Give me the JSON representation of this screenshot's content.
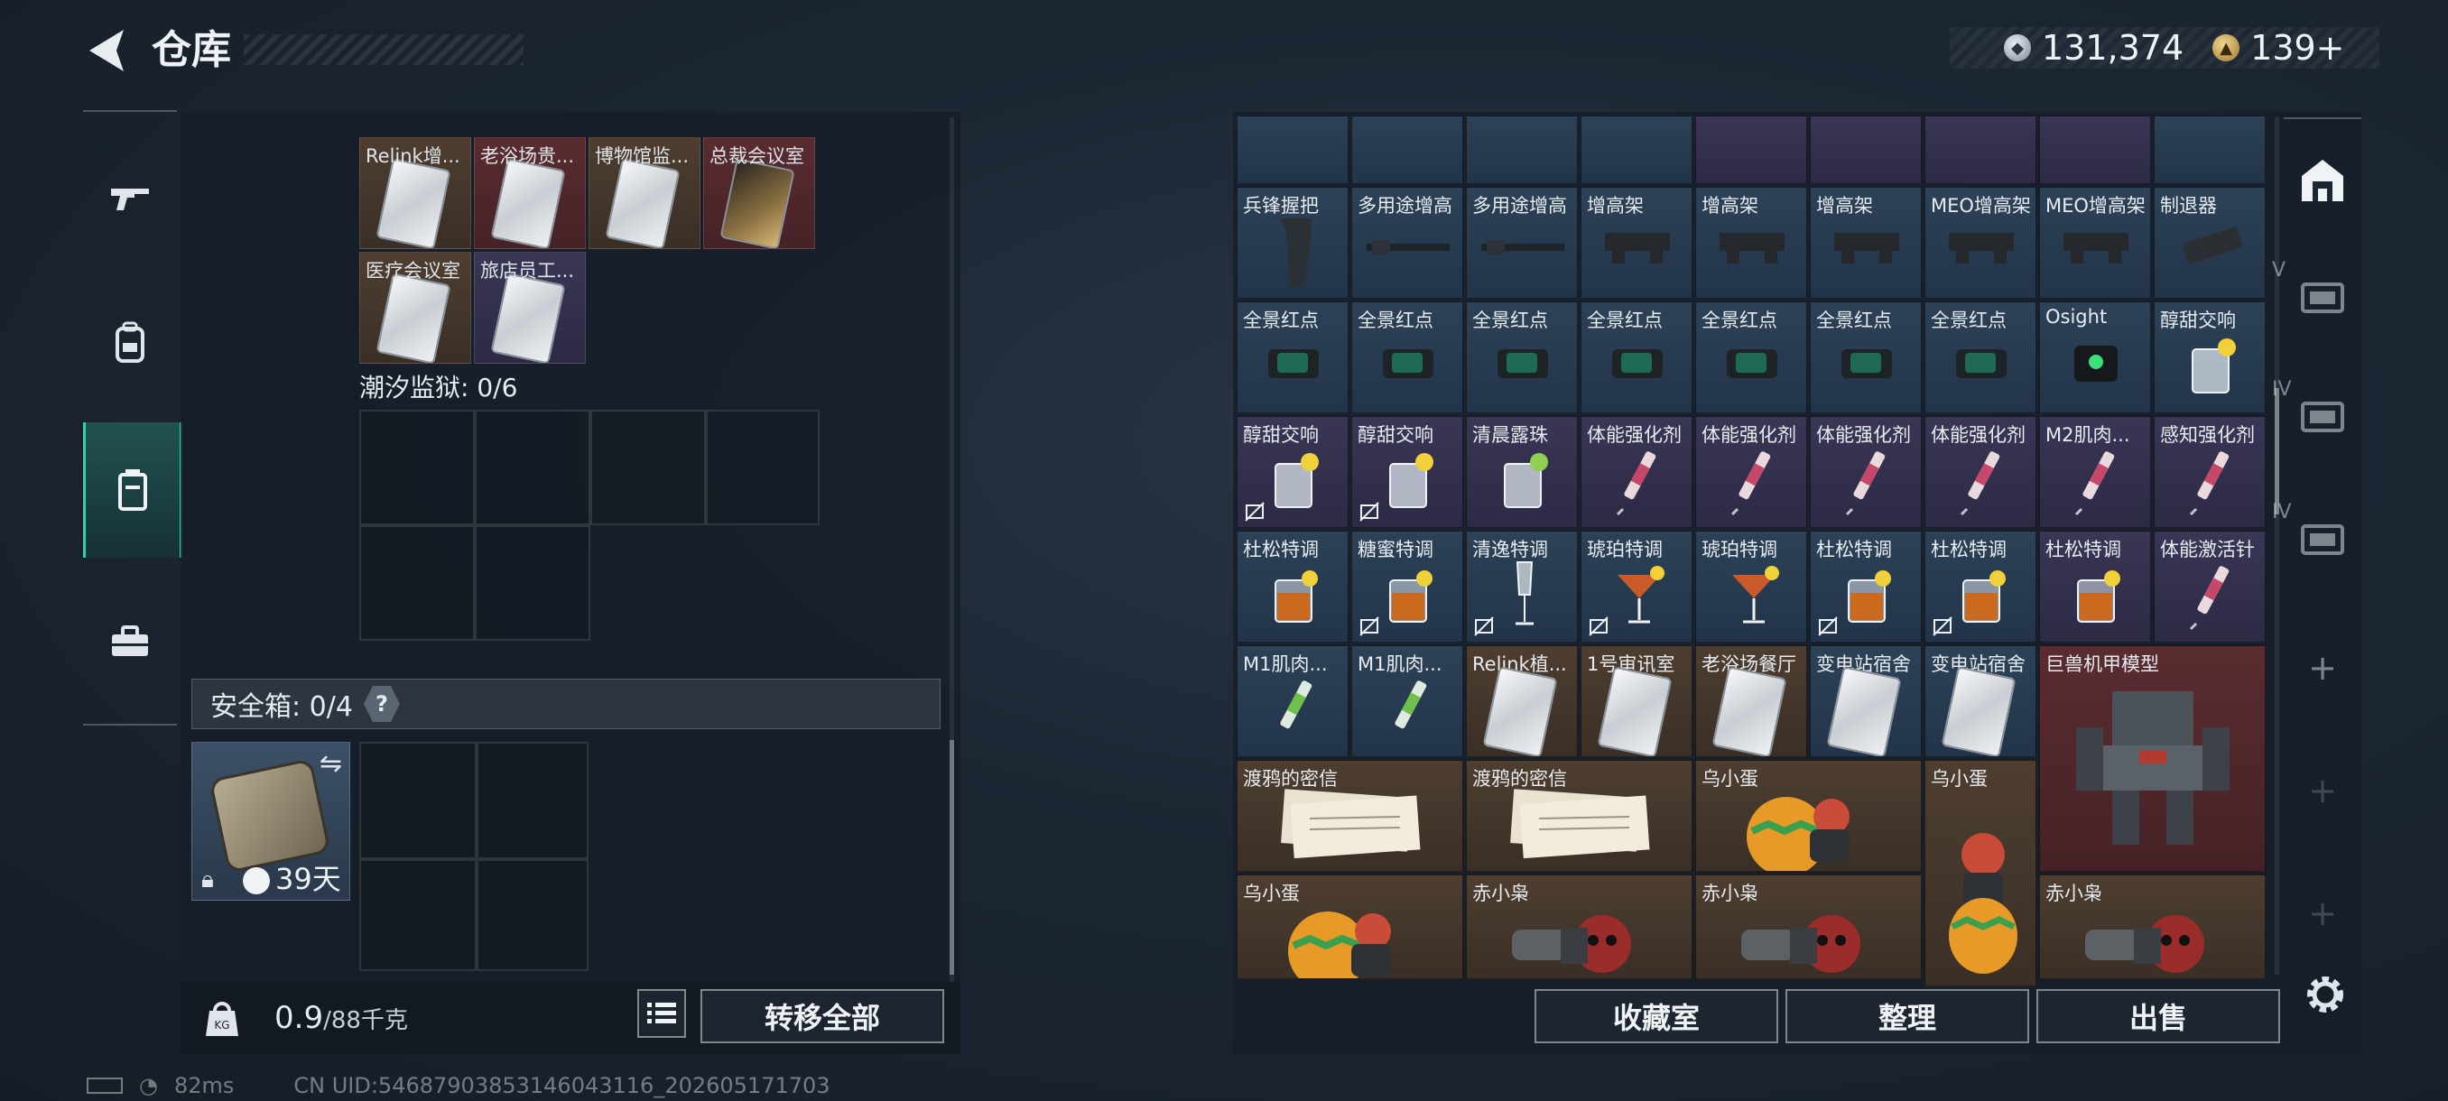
{
  "header": {
    "title": "仓库"
  },
  "currencies": [
    {
      "icon": "silver-coin-icon",
      "value": "131,374"
    },
    {
      "icon": "gold-coin-icon",
      "value": "139+"
    }
  ],
  "left_nav": [
    {
      "name": "nav-weapons",
      "icon": "gun-icon"
    },
    {
      "name": "nav-equipment",
      "icon": "backpack-icon"
    },
    {
      "name": "nav-keycards",
      "icon": "keycard-case-icon",
      "active": true
    },
    {
      "name": "nav-toolbox",
      "icon": "toolbox-icon"
    }
  ],
  "keycards_top": [
    {
      "label": "Relink增...",
      "bg": "brown"
    },
    {
      "label": "老浴场贵...",
      "bg": "red"
    },
    {
      "label": "博物馆监...",
      "bg": "brown"
    },
    {
      "label": "总裁会议室",
      "bg": "red"
    },
    {
      "label": "医疗会议室",
      "bg": "brown"
    },
    {
      "label": "旅店员工...",
      "bg": "purple"
    }
  ],
  "prison": {
    "label": "潮汐监狱: 0/6"
  },
  "safe": {
    "label": "安全箱: 0/4",
    "help": "?",
    "item_days": "39天"
  },
  "weight": {
    "current": "0.9",
    "max": "/88千克"
  },
  "buttons": {
    "transfer_all": "转移全部",
    "collection": "收藏室",
    "organize": "整理",
    "sell": "出售"
  },
  "status": {
    "ping": "82ms",
    "uid": "CN UID:5468790385314604311­6_202605171703"
  },
  "items": {
    "row1": [
      {
        "label": "兵锋握把",
        "bg": "blue",
        "icon": "grip-icon"
      },
      {
        "label": "多用途增高",
        "bg": "blue",
        "icon": "rail-riser-icon"
      },
      {
        "label": "多用途增高",
        "bg": "blue",
        "icon": "rail-riser-icon"
      },
      {
        "label": "增高架",
        "bg": "blue",
        "icon": "mount-icon"
      },
      {
        "label": "增高架",
        "bg": "blue",
        "icon": "mount-icon"
      },
      {
        "label": "增高架",
        "bg": "blue",
        "icon": "mount-icon"
      },
      {
        "label": "MEO增高架",
        "bg": "blue",
        "icon": "mount-icon"
      },
      {
        "label": "MEO增高架",
        "bg": "blue",
        "icon": "mount-icon"
      },
      {
        "label": "制退器",
        "bg": "blue",
        "icon": "muzzle-brake-icon"
      }
    ],
    "row2": [
      {
        "label": "全景红点",
        "bg": "blue",
        "icon": "red-dot-sight-icon"
      },
      {
        "label": "全景红点",
        "bg": "blue",
        "icon": "red-dot-sight-icon"
      },
      {
        "label": "全景红点",
        "bg": "blue",
        "icon": "red-dot-sight-icon"
      },
      {
        "label": "全景红点",
        "bg": "blue",
        "icon": "red-dot-sight-icon"
      },
      {
        "label": "全景红点",
        "bg": "blue",
        "icon": "red-dot-sight-icon"
      },
      {
        "label": "全景红点",
        "bg": "blue",
        "icon": "red-dot-sight-icon"
      },
      {
        "label": "全景红点",
        "bg": "blue",
        "icon": "red-dot-sight-icon"
      },
      {
        "label": "Osight",
        "bg": "blue",
        "icon": "osight-icon"
      },
      {
        "label": "醇甜交响",
        "bg": "blue",
        "icon": "cocktail-glass-icon"
      }
    ],
    "row3": [
      {
        "label": "醇甜交响",
        "bg": "purple",
        "icon": "cocktail-glass-icon",
        "no_trade": true
      },
      {
        "label": "醇甜交响",
        "bg": "purple",
        "icon": "cocktail-glass-icon",
        "no_trade": true
      },
      {
        "label": "清晨露珠",
        "bg": "purple",
        "icon": "mojito-glass-icon"
      },
      {
        "label": "体能强化剂",
        "bg": "purple",
        "icon": "syringe-icon"
      },
      {
        "label": "体能强化剂",
        "bg": "purple",
        "icon": "syringe-icon"
      },
      {
        "label": "体能强化剂",
        "bg": "purple",
        "icon": "syringe-icon"
      },
      {
        "label": "体能强化剂",
        "bg": "purple",
        "icon": "syringe-icon"
      },
      {
        "label": "M2肌肉...",
        "bg": "purple",
        "icon": "syringe-icon"
      },
      {
        "label": "感知强化剂",
        "bg": "purple",
        "icon": "syringe-icon"
      }
    ],
    "row4": [
      {
        "label": "杜松特调",
        "bg": "blue",
        "icon": "whisky-glass-icon"
      },
      {
        "label": "糖蜜特调",
        "bg": "blue",
        "icon": "whisky-glass-icon",
        "no_trade": true
      },
      {
        "label": "清逸特调",
        "bg": "blue",
        "icon": "champagne-glass-icon",
        "no_trade": true
      },
      {
        "label": "琥珀特调",
        "bg": "blue",
        "icon": "martini-glass-icon",
        "no_trade": true
      },
      {
        "label": "琥珀特调",
        "bg": "blue",
        "icon": "martini-glass-icon"
      },
      {
        "label": "杜松特调",
        "bg": "blue",
        "icon": "whisky-glass-icon",
        "no_trade": true
      },
      {
        "label": "杜松特调",
        "bg": "blue",
        "icon": "whisky-glass-icon",
        "no_trade": true
      },
      {
        "label": "杜松特调",
        "bg": "purple",
        "icon": "whisky-glass-icon"
      },
      {
        "label": "体能激活针",
        "bg": "purple",
        "icon": "syringe-icon"
      }
    ],
    "row5": [
      {
        "label": "M1肌肉...",
        "bg": "blue",
        "icon": "injector-icon"
      },
      {
        "label": "M1肌肉...",
        "bg": "blue",
        "icon": "injector-icon"
      },
      {
        "label": "Relink植...",
        "bg": "brown",
        "icon": "keycard-icon"
      },
      {
        "label": "1号审讯室",
        "bg": "brown",
        "icon": "keycard-icon"
      },
      {
        "label": "老浴场餐厅",
        "bg": "brown",
        "icon": "keycard-icon"
      },
      {
        "label": "变电站宿舍",
        "bg": "blue",
        "icon": "keycard-icon"
      },
      {
        "label": "变电站宿舍",
        "bg": "blue",
        "icon": "keycard-icon"
      }
    ],
    "big": {
      "mech": {
        "label": "巨兽机甲模型",
        "icon": "mech-model-icon"
      },
      "raven1": {
        "label": "渡鸦的密信",
        "icon": "letter-icon"
      },
      "raven2": {
        "label": "渡鸦的密信",
        "icon": "letter-icon"
      },
      "egg1": {
        "label": "乌小蛋",
        "icon": "egg-figure-icon"
      },
      "egg2": {
        "label": "乌小蛋",
        "icon": "egg-figure-icon"
      },
      "egg3": {
        "label": "乌小蛋",
        "icon": "egg-figure-icon"
      },
      "owl1": {
        "label": "赤小枭",
        "icon": "owl-figure-icon"
      },
      "owl2": {
        "label": "赤小枭",
        "icon": "owl-figure-icon"
      },
      "owl3": {
        "label": "赤小枭",
        "icon": "owl-figure-icon"
      }
    }
  },
  "right_side": [
    {
      "name": "side-warehouse",
      "icon": "warehouse-icon",
      "text": ""
    },
    {
      "name": "side-storage-v",
      "icon": "storage-v-icon",
      "text": "V"
    },
    {
      "name": "side-storage-iv",
      "icon": "storage-iv-icon",
      "text": "IV"
    },
    {
      "name": "side-storage-iv-add",
      "icon": "storage-iv-add-icon",
      "text": "IV"
    },
    {
      "name": "side-add-1",
      "icon": "plus-icon",
      "text": "+"
    },
    {
      "name": "side-add-2",
      "icon": "plus-icon",
      "text": "+"
    },
    {
      "name": "side-add-3",
      "icon": "plus-icon",
      "text": "+"
    }
  ]
}
